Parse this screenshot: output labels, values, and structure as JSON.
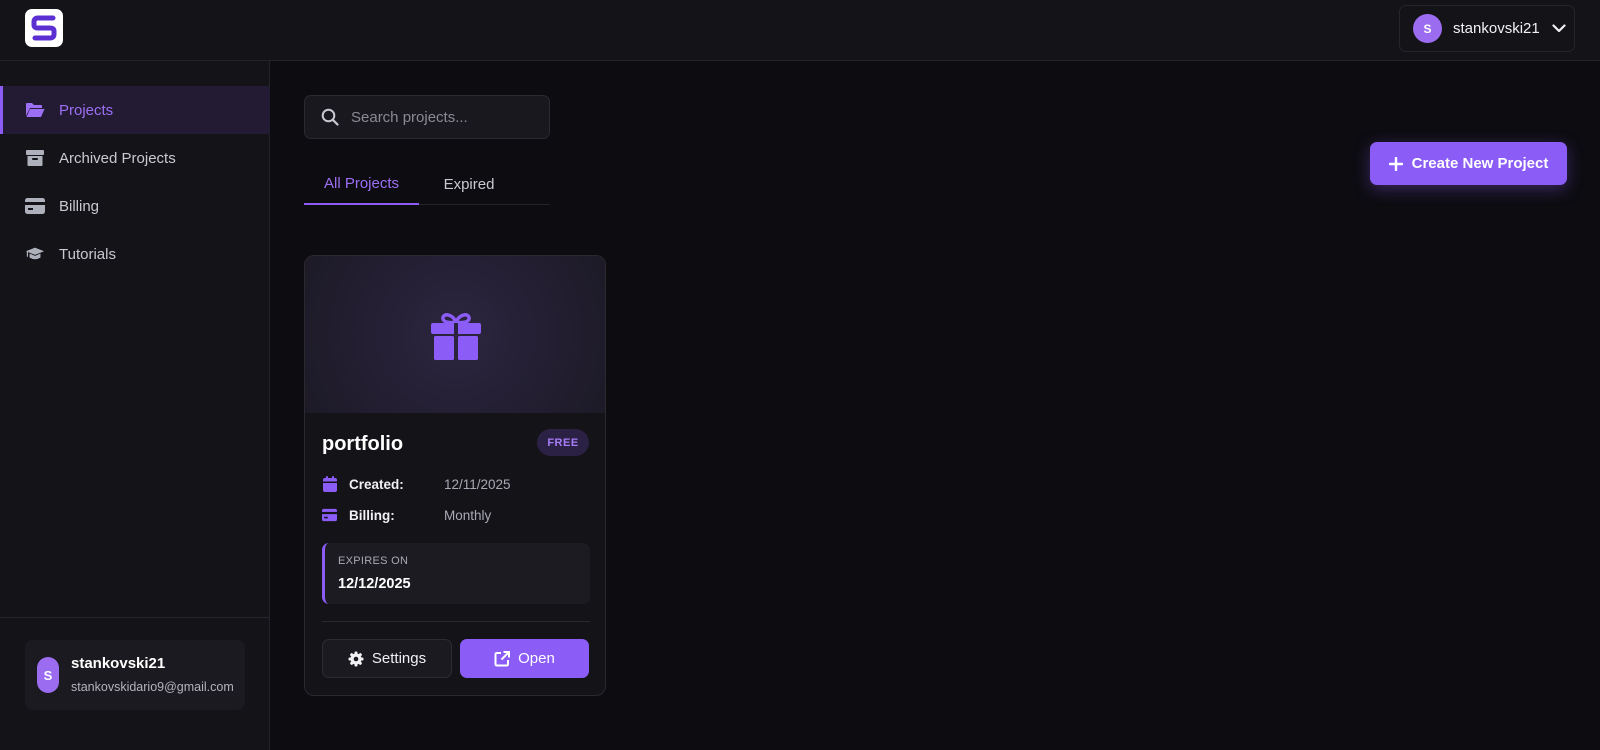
{
  "header": {
    "user": {
      "initial": "S",
      "username": "stankovski21"
    }
  },
  "sidebar": {
    "items": [
      {
        "label": "Projects",
        "icon": "folder-open-icon",
        "active": true
      },
      {
        "label": "Archived Projects",
        "icon": "archive-box-icon",
        "active": false
      },
      {
        "label": "Billing",
        "icon": "credit-card-icon",
        "active": false
      },
      {
        "label": "Tutorials",
        "icon": "graduation-cap-icon",
        "active": false
      }
    ],
    "profile": {
      "initial": "S",
      "username": "stankovski21",
      "email": "stankovskidario9@gmail.com"
    }
  },
  "main": {
    "search": {
      "placeholder": "Search projects...",
      "value": ""
    },
    "tabs": [
      {
        "label": "All Projects",
        "active": true
      },
      {
        "label": "Expired",
        "active": false
      }
    ],
    "create_button": {
      "label": "Create New Project"
    },
    "projects": [
      {
        "name": "portfolio",
        "plan_badge": "FREE",
        "created_label": "Created:",
        "created_value": "12/11/2025",
        "billing_label": "Billing:",
        "billing_value": "Monthly",
        "expires_label": "EXPIRES ON",
        "expires_value": "12/12/2025",
        "settings_label": "Settings",
        "open_label": "Open"
      }
    ]
  },
  "colors": {
    "accent": "#8b5cf6",
    "background": "#0d0c11",
    "panel": "#141318"
  }
}
